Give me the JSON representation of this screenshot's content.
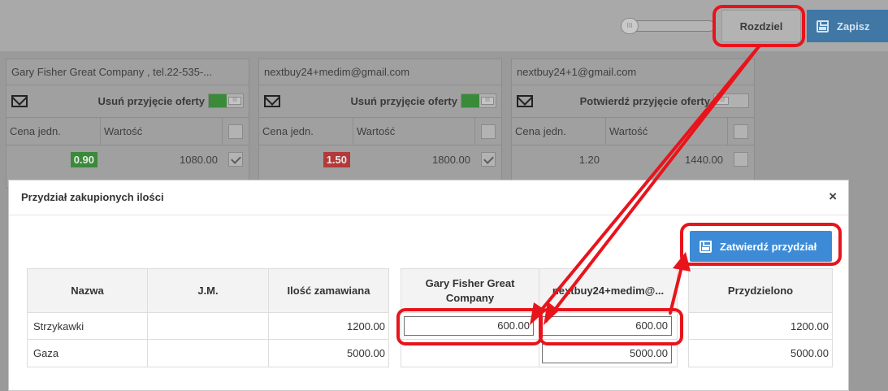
{
  "toolbar": {
    "split_label": "Rozdziel",
    "save_label": "Zapisz",
    "toggle_glyph": "III"
  },
  "cards": [
    {
      "header": "Gary Fisher Great Company , tel.22-535-...",
      "action_label": "Usuń przyjęcie oferty",
      "toggle_state": "on",
      "col_unit_price": "Cena jedn.",
      "col_value": "Wartość",
      "unit_price": "0.90",
      "unit_price_color": "#3a8a3a",
      "value": "1080.00",
      "checked": true
    },
    {
      "header": "nextbuy24+medim@gmail.com",
      "action_label": "Usuń przyjęcie oferty",
      "toggle_state": "on",
      "col_unit_price": "Cena jedn.",
      "col_value": "Wartość",
      "unit_price": "1.50",
      "unit_price_color": "#b33a3a",
      "value": "1800.00",
      "checked": true
    },
    {
      "header": "nextbuy24+1@gmail.com",
      "action_label": "Potwierdź przyjęcie oferty",
      "toggle_state": "off",
      "col_unit_price": "Cena jedn.",
      "col_value": "Wartość",
      "unit_price": "1.20",
      "unit_price_color": "",
      "value": "1440.00",
      "checked": false
    }
  ],
  "modal": {
    "title": "Przydział zakupionych ilości",
    "close_glyph": "×",
    "confirm_label": "Zatwierdź przydział",
    "columns": {
      "name": "Nazwa",
      "unit": "J.M.",
      "ordered_qty": "Ilość zamawiana",
      "supplier1": "Gary Fisher Great Company",
      "supplier2": "nextbuy24+medim@...",
      "allocated": "Przydzielono"
    },
    "rows": [
      {
        "name": "Strzykawki",
        "unit": "",
        "ordered_qty": "1200.00",
        "supplier1": "600.00",
        "supplier2": "600.00",
        "allocated": "1200.00"
      },
      {
        "name": "Gaza",
        "unit": "",
        "ordered_qty": "5000.00",
        "supplier1": "",
        "supplier2": "5000.00",
        "allocated": "5000.00"
      }
    ]
  },
  "annotation_color": "#e8141c",
  "accent_blue": "#3d8bd6"
}
